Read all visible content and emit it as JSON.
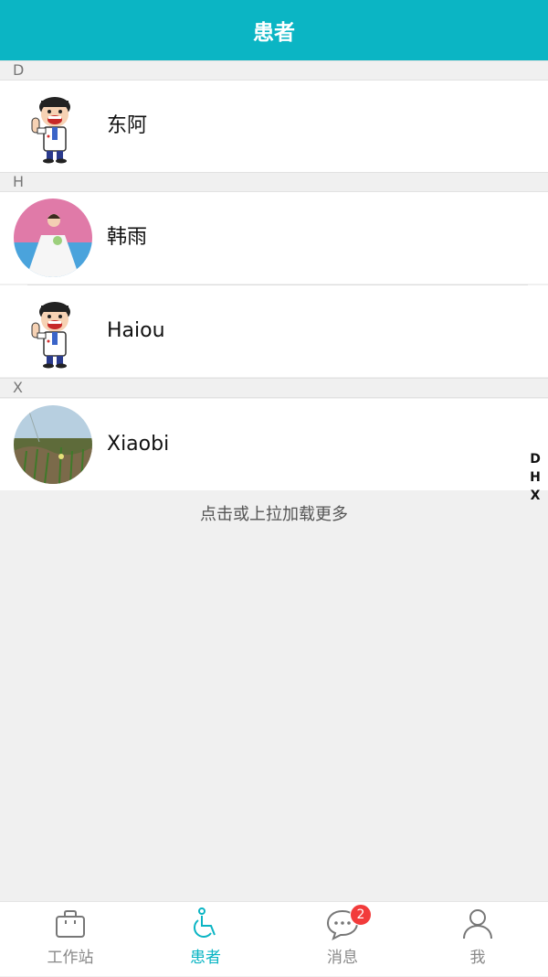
{
  "header": {
    "title": "患者"
  },
  "sections": [
    {
      "letter": "D",
      "patients": [
        {
          "name": "东阿",
          "avatar_icon": "cartoon-doctor-avatar"
        }
      ]
    },
    {
      "letter": "H",
      "patients": [
        {
          "name": "韩雨",
          "avatar_icon": "bride-photo-avatar"
        },
        {
          "name": "Haiou",
          "avatar_icon": "cartoon-doctor-avatar"
        }
      ]
    },
    {
      "letter": "X",
      "patients": [
        {
          "name": "Xiaobi",
          "avatar_icon": "grass-photo-avatar"
        }
      ]
    }
  ],
  "index_bar": [
    "D",
    "H",
    "X"
  ],
  "load_more": "点击或上拉加载更多",
  "tabbar": {
    "tabs": [
      {
        "label": "工作站",
        "icon": "briefcase-icon"
      },
      {
        "label": "患者",
        "icon": "wheelchair-icon",
        "active": true
      },
      {
        "label": "消息",
        "icon": "chat-bubble-icon",
        "badge": "2"
      },
      {
        "label": "我",
        "icon": "person-icon"
      }
    ]
  },
  "colors": {
    "accent": "#0bb5c4",
    "badge": "#f23b3b",
    "background": "#f0f0f0"
  }
}
